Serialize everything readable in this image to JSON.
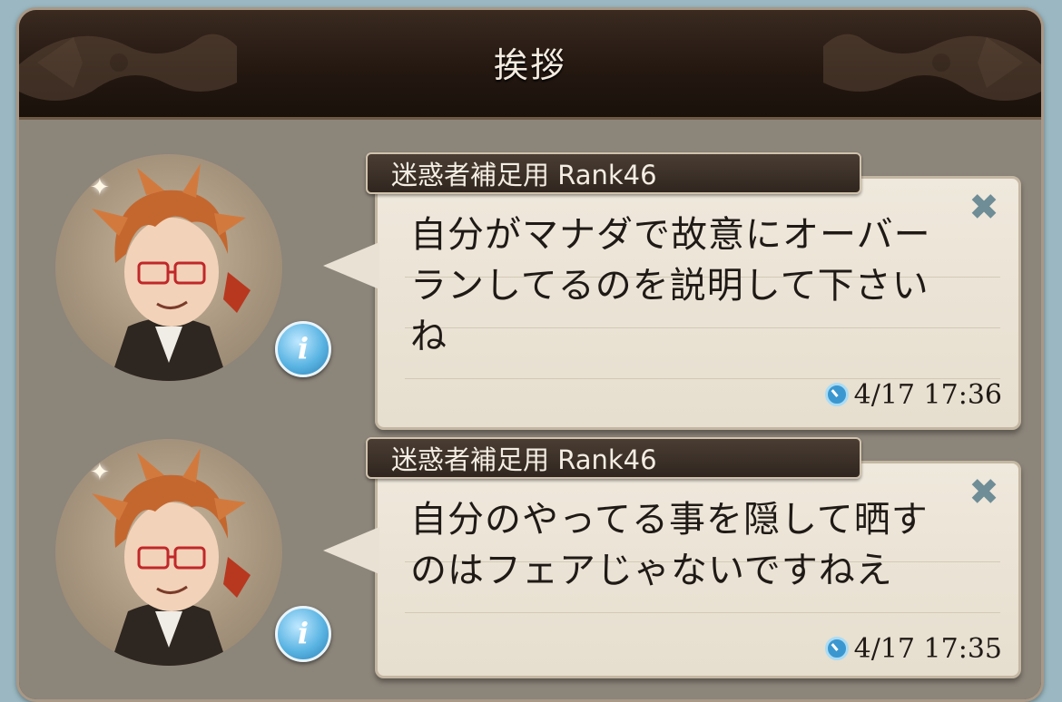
{
  "header": {
    "title": "挨拶"
  },
  "messages": [
    {
      "sender": "迷惑者補足用 Rank46",
      "text": "自分がマナダで故意にオーバー\nランしてるのを説明して下さい\nね",
      "time": "4/17  17:36",
      "close_icon": "close-icon",
      "info_icon": "info-icon",
      "clock_icon": "clock-icon"
    },
    {
      "sender": "迷惑者補足用 Rank46",
      "text": "自分のやってる事を隠して晒す\nのはフェアじゃないですねえ",
      "time": "4/17  17:35",
      "close_icon": "close-icon",
      "info_icon": "info-icon",
      "clock_icon": "clock-icon"
    }
  ],
  "colors": {
    "header_bg": "#241811",
    "bubble_bg": "#efe8dc",
    "nameplate_bg": "#3b3028",
    "close_icon": "#6e8d96",
    "info_badge": "#5bb5e3"
  }
}
